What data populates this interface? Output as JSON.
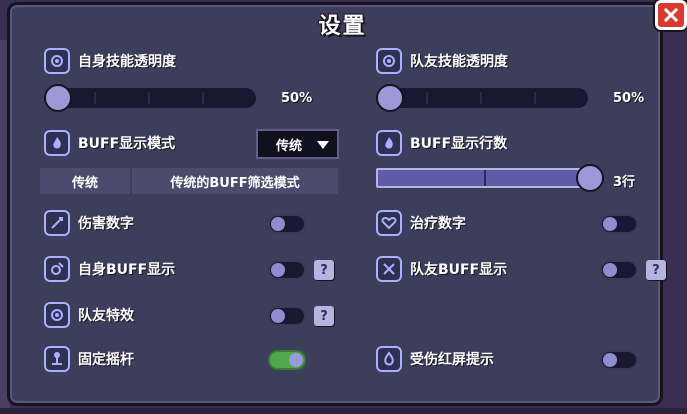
{
  "window": {
    "title": "设置"
  },
  "close_icon": "close-icon",
  "left": {
    "self_skill_opacity": {
      "label": "自身技能透明度",
      "value_text": "50%",
      "value": 0.1
    },
    "buff_display_mode": {
      "label": "BUFF显示模式",
      "selected": "传统",
      "mode_name": "传统",
      "mode_desc": "传统的BUFF筛选模式"
    },
    "damage_numbers": {
      "label": "伤害数字",
      "on": false
    },
    "self_buff": {
      "label": "自身BUFF显示",
      "on": false,
      "help": "?"
    },
    "team_effects": {
      "label": "队友特效",
      "on": false,
      "help": "?"
    },
    "fixed_joystick": {
      "label": "固定摇杆",
      "on": true
    }
  },
  "right": {
    "team_skill_opacity": {
      "label": "队友技能透明度",
      "value_text": "50%",
      "value": 0.1
    },
    "buff_rows": {
      "label": "BUFF显示行数",
      "value_text": "3行",
      "value": 3,
      "max": 3
    },
    "heal_numbers": {
      "label": "治疗数字",
      "on": false
    },
    "team_buff": {
      "label": "队友BUFF显示",
      "on": false,
      "help": "?"
    },
    "damage_red_screen": {
      "label": "受伤红屏提示",
      "on": false
    }
  },
  "colors": {
    "accent": "#5e5ca8",
    "toggle_on": "#4fa84c",
    "close": "#d83a2e"
  }
}
